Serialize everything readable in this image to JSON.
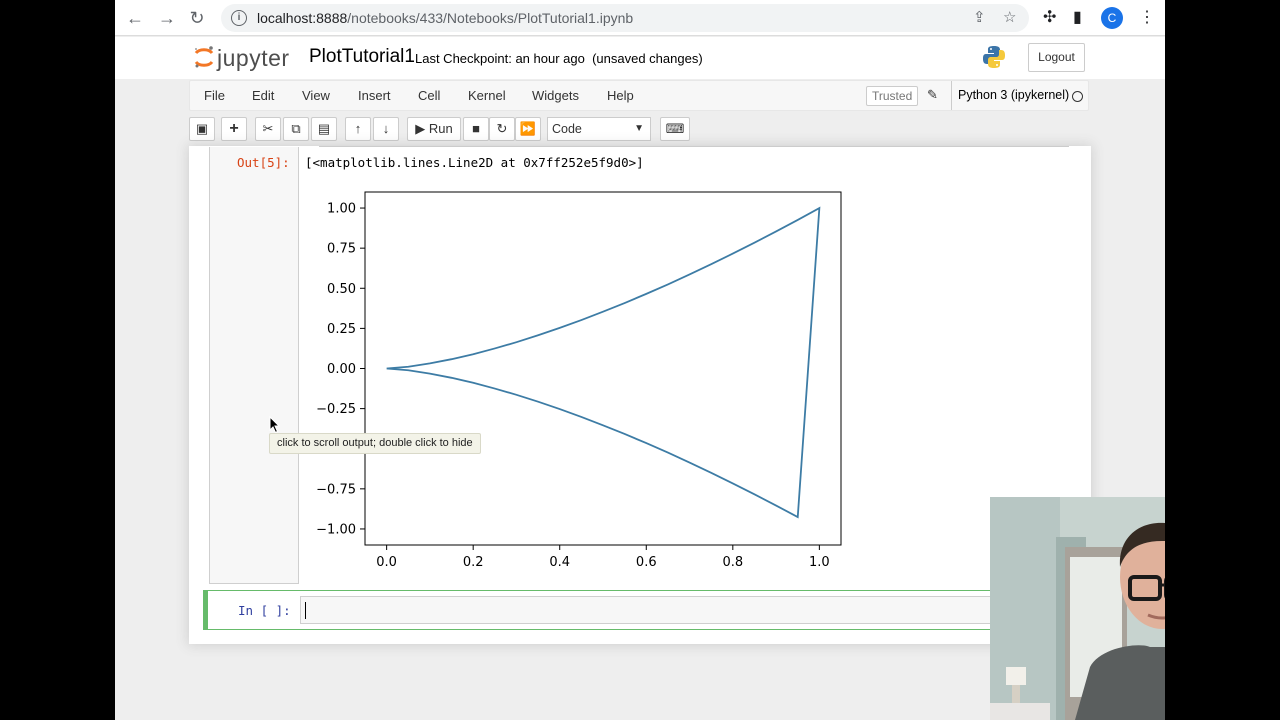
{
  "browser": {
    "url_host": "localhost:8888",
    "url_path": "/notebooks/433/Notebooks/PlotTutorial1.ipynb",
    "profile_initial": "C"
  },
  "header": {
    "logo_text": "jupyter",
    "notebook_name": "PlotTutorial1",
    "checkpoint": "Last Checkpoint: an hour ago",
    "unsaved": "(unsaved changes)",
    "logout_label": "Logout"
  },
  "menubar": {
    "items": [
      "File",
      "Edit",
      "View",
      "Insert",
      "Cell",
      "Kernel",
      "Widgets",
      "Help"
    ],
    "trusted_label": "Trusted",
    "kernel_name": "Python 3 (ipykernel)"
  },
  "toolbar": {
    "run_label": "Run",
    "cell_type": "Code"
  },
  "output_cell": {
    "prompt": "Out[5]:",
    "text": "[<matplotlib.lines.Line2D at 0x7ff252e5f9d0>]"
  },
  "tooltip": "click to scroll output; double click to hide",
  "input_cell": {
    "prompt": "In [ ]:"
  },
  "chart_data": {
    "type": "line",
    "title": "",
    "xlabel": "",
    "ylabel": "",
    "xlim": [
      -0.05,
      1.05
    ],
    "ylim": [
      -1.1,
      1.1
    ],
    "xticks": [
      "0.0",
      "0.2",
      "0.4",
      "0.6",
      "0.8",
      "1.0"
    ],
    "yticks": [
      "1.00",
      "0.75",
      "0.50",
      "0.25",
      "0.00",
      "−0.25",
      "−0.50",
      "−0.75",
      "−1.00"
    ],
    "line_color": "#3d7ca5",
    "series": [
      {
        "x": [
          0.0,
          0.05,
          0.1,
          0.15,
          0.2,
          0.25,
          0.3,
          0.35,
          0.4,
          0.45,
          0.5,
          0.55,
          0.6,
          0.65,
          0.7,
          0.75,
          0.8,
          0.85,
          0.9,
          0.95,
          1.0,
          0.95,
          0.9,
          0.85,
          0.8,
          0.75,
          0.7,
          0.65,
          0.6,
          0.55,
          0.5,
          0.45,
          0.4,
          0.35,
          0.3,
          0.25,
          0.2,
          0.15,
          0.1,
          0.05,
          0.0
        ],
        "y": [
          0.0,
          0.011,
          0.032,
          0.058,
          0.089,
          0.125,
          0.164,
          0.207,
          0.253,
          0.302,
          0.354,
          0.408,
          0.465,
          0.524,
          0.586,
          0.65,
          0.716,
          0.784,
          0.854,
          0.926,
          1.0,
          -0.926,
          -0.854,
          -0.784,
          -0.716,
          -0.65,
          -0.586,
          -0.524,
          -0.465,
          -0.408,
          -0.354,
          -0.302,
          -0.253,
          -0.207,
          -0.164,
          -0.125,
          -0.089,
          -0.058,
          -0.032,
          -0.011,
          0.0
        ]
      }
    ]
  }
}
